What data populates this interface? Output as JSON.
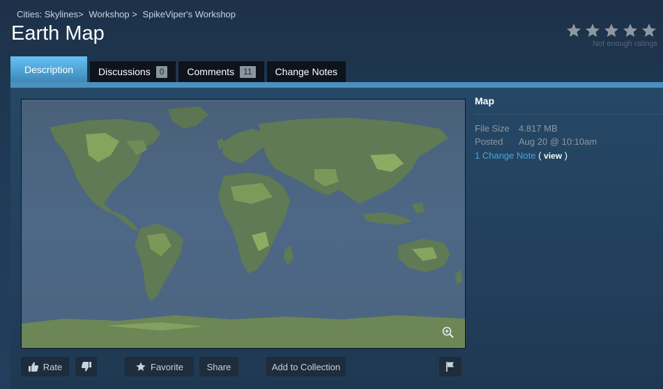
{
  "breadcrumb": {
    "items": [
      {
        "label": "Cities: Skylines"
      },
      {
        "label": "Workshop"
      },
      {
        "label": "SpikeViper's Workshop"
      }
    ],
    "sep1": ">",
    "sep2": ">"
  },
  "page_title": "Earth Map",
  "rating": {
    "stars_filled": 0,
    "stars_total": 5,
    "text": "Not enough ratings",
    "star_color": "#8f98a0"
  },
  "tabs": [
    {
      "label": "Description",
      "active": true
    },
    {
      "label": "Discussions",
      "count": "0"
    },
    {
      "label": "Comments",
      "count": "11"
    },
    {
      "label": "Change Notes"
    }
  ],
  "details": {
    "tag": "Map",
    "file_size_label": "File Size",
    "file_size_value": "4.817 MB",
    "posted_label": "Posted",
    "posted_value": "Aug 20 @ 10:10am",
    "change_note_link": "1 Change Note",
    "view_open": "( ",
    "view_label": "view",
    "view_close": " )"
  },
  "actions": {
    "rate": "Rate",
    "favorite": "Favorite",
    "share": "Share",
    "add_to_collection": "Add to Collection"
  },
  "icons": {
    "thumbs_up": "thumbs-up-icon",
    "thumbs_down": "thumbs-down-icon",
    "favorite": "star-icon",
    "flag": "flag-icon",
    "zoom": "zoom-in-icon"
  },
  "colors": {
    "accent_tab": "#67c1f5",
    "link": "#4ca3d8",
    "ocean": "#4b6481",
    "land": "#5f7a55"
  }
}
